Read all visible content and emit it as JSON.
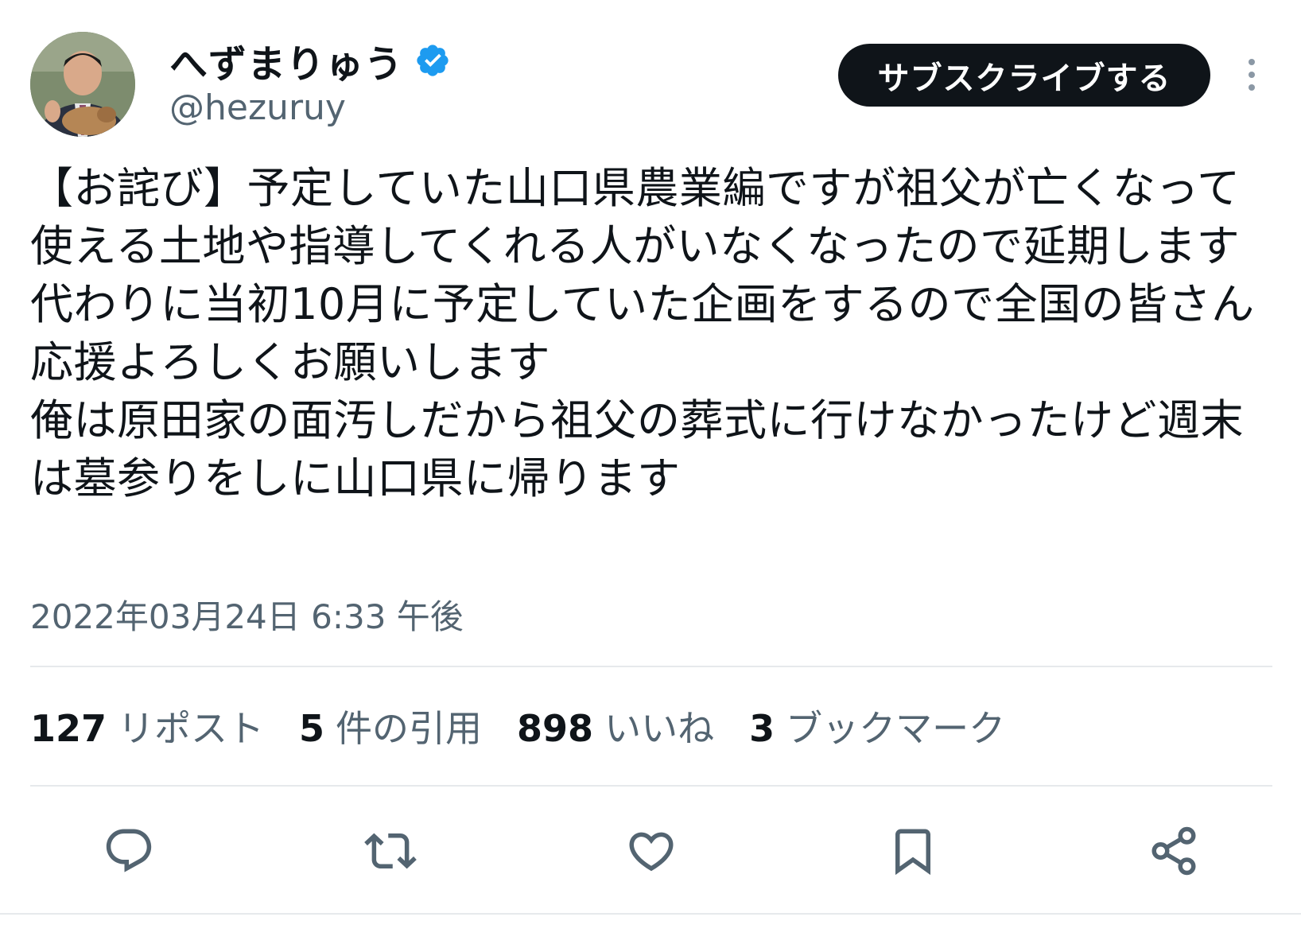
{
  "author": {
    "display_name": "へずまりゅう",
    "handle": "@hezuruy",
    "verified": true,
    "verified_color": "#1d9bf0"
  },
  "header": {
    "subscribe_label": "サブスクライブする",
    "more_icon": "more-vertical-icon"
  },
  "tweet": {
    "text": "【お詫び】予定していた山口県農業編ですが祖父が亡くなって使える土地や指導してくれる人がいなくなったので延期します\n代わりに当初10月に予定していた企画をするので全国の皆さん応援よろしくお願いします\n俺は原田家の面汚しだから祖父の葬式に行けなかったけど週末は墓参りをしに山口県に帰ります",
    "timestamp": "2022年03月24日 6:33 午後"
  },
  "stats": {
    "reposts": {
      "count": "127",
      "label": "リポスト"
    },
    "quotes": {
      "count": "5",
      "label": "件の引用"
    },
    "likes": {
      "count": "898",
      "label": "いいね"
    },
    "bookmarks": {
      "count": "3",
      "label": "ブックマーク"
    }
  },
  "actions": [
    "reply-icon",
    "repost-icon",
    "like-icon",
    "bookmark-icon",
    "share-icon"
  ],
  "colors": {
    "text": "#0f1419",
    "secondary": "#536471",
    "divider": "#e6e9ec",
    "button_bg": "#0f1419"
  }
}
